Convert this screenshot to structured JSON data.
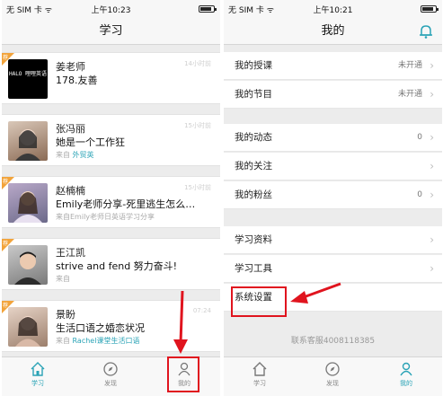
{
  "left_screen": {
    "status": {
      "carrier": "无 SIM 卡 ᯤ",
      "time": "上午10:23"
    },
    "title": "学习",
    "items": [
      {
        "name": "姜老师",
        "message": "178.友善",
        "source": "",
        "source_tag": "",
        "time": "14小时前",
        "avatar_text": "HALO 哩哩英语",
        "badge": "荐"
      },
      {
        "name": "张冯丽",
        "message": "她是一个工作狂",
        "source": "来自",
        "source_tag": "外贸英",
        "time": "15小时前",
        "badge": ""
      },
      {
        "name": "赵楠楠",
        "message": "Emily老师分享-死里逃生怎么…",
        "source": "来自Emily老师日英语学习分享",
        "source_tag": "",
        "time": "15小时前",
        "badge": "荐"
      },
      {
        "name": "王江凯",
        "message": "strive and fend 努力奋斗!",
        "source": "来自",
        "source_tag": "",
        "time": "",
        "badge": "荐"
      },
      {
        "name": "景盼",
        "message": "生活口语之婚恋状况",
        "source": "来自",
        "source_tag": "Rachel课堂生活口语",
        "time": "07:24",
        "badge": "荐"
      }
    ],
    "tabs": [
      {
        "label": "学习"
      },
      {
        "label": "发现"
      },
      {
        "label": "我的"
      }
    ]
  },
  "right_screen": {
    "status": {
      "carrier": "无 SIM 卡 ᯤ",
      "time": "上午10:21"
    },
    "title": "我的",
    "rows": [
      {
        "label": "我的授课",
        "value": "未开通"
      },
      {
        "label": "我的节目",
        "value": "未开通"
      },
      {
        "label": "我的动态",
        "value": "0"
      },
      {
        "label": "我的关注",
        "value": ""
      },
      {
        "label": "我的粉丝",
        "value": "0"
      },
      {
        "label": "学习资料",
        "value": ""
      },
      {
        "label": "学习工具",
        "value": ""
      },
      {
        "label": "系统设置",
        "value": ""
      }
    ],
    "footer": "联系客服4008118385",
    "tabs": [
      {
        "label": "学习"
      },
      {
        "label": "发现"
      },
      {
        "label": "我的"
      }
    ]
  },
  "colors": {
    "accent": "#2aa3b6",
    "badge": "#f2a33a",
    "highlight": "#e0141e"
  },
  "icons": [
    "wifi-icon",
    "battery-icon",
    "bell-icon",
    "home-icon",
    "compass-icon",
    "person-icon",
    "chevron-right-icon",
    "red-arrow"
  ]
}
